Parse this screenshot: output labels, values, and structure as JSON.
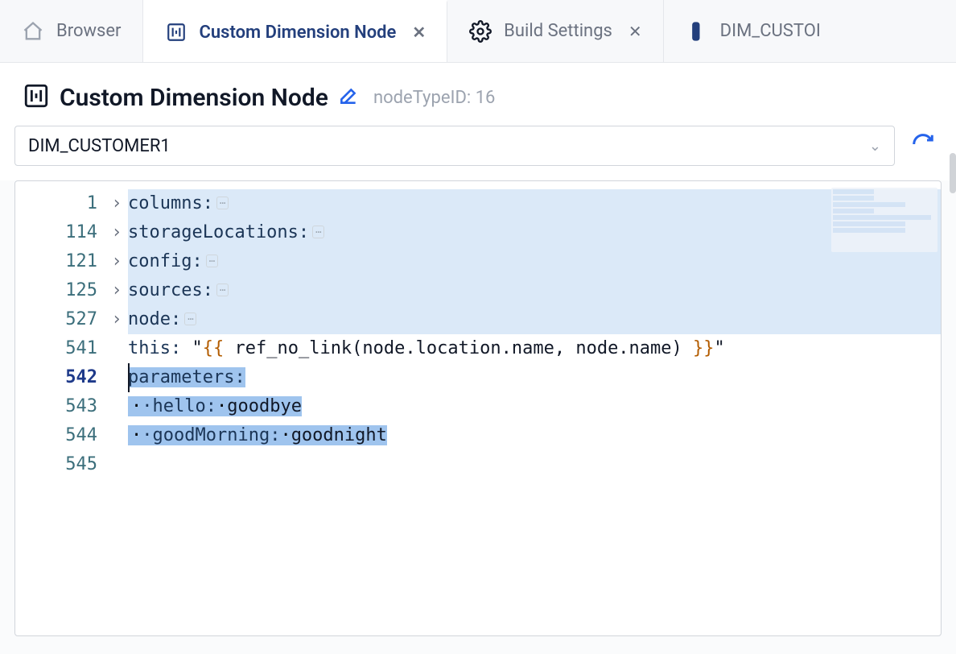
{
  "tabs": [
    {
      "label": "Browser",
      "icon": "home",
      "closable": false,
      "active": false
    },
    {
      "label": "Custom Dimension Node",
      "icon": "dimension",
      "closable": true,
      "active": true
    },
    {
      "label": "Build Settings",
      "icon": "gear",
      "closable": true,
      "active": false
    },
    {
      "label": "DIM_CUSTOI",
      "icon": "bar",
      "closable": false,
      "active": false
    }
  ],
  "header": {
    "title": "Custom Dimension Node",
    "meta": "nodeTypeID: 16",
    "icon": "dimension"
  },
  "select": {
    "value": "DIM_CUSTOMER1"
  },
  "editor": {
    "lines": [
      {
        "num": "1",
        "fold": true,
        "key": "columns:",
        "rest": "",
        "hl": true
      },
      {
        "num": "114",
        "fold": true,
        "key": "storageLocations:",
        "rest": "",
        "hl": true
      },
      {
        "num": "121",
        "fold": true,
        "key": "config:",
        "rest": "",
        "hl": true
      },
      {
        "num": "125",
        "fold": true,
        "key": "sources:",
        "rest": "",
        "hl": true
      },
      {
        "num": "527",
        "fold": true,
        "key": "node:",
        "rest": "",
        "hl": true
      },
      {
        "num": "541",
        "fold": false,
        "key": "this:",
        "rest": " \"{{ ref_no_link(node.location.name, node.name) }}\"",
        "hl": false
      },
      {
        "num": "542",
        "fold": false,
        "key": "parameters:",
        "rest": "",
        "hl": false,
        "cursor": true,
        "sel": "parameters:"
      },
      {
        "num": "543",
        "fold": false,
        "key": "  hello:",
        "rest": " goodbye",
        "hl": false,
        "selFull": true
      },
      {
        "num": "544",
        "fold": false,
        "key": "  goodMorning:",
        "rest": " goodnight",
        "hl": false,
        "selFull": true
      },
      {
        "num": "545",
        "fold": false,
        "key": "",
        "rest": "",
        "hl": false
      }
    ]
  }
}
